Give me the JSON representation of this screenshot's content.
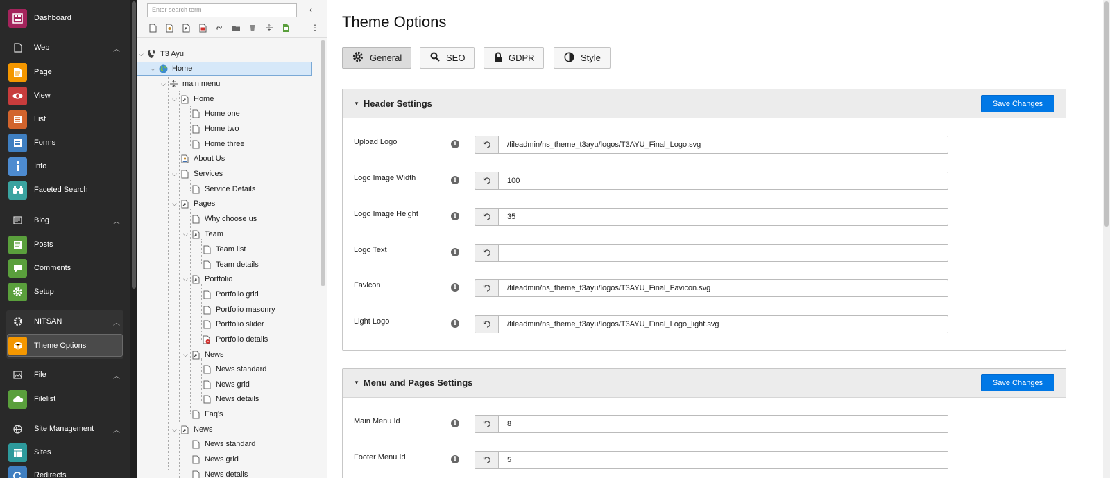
{
  "module_menu": {
    "dashboard": "Dashboard",
    "groups": {
      "web": "Web",
      "blog": "Blog",
      "nitsan": "NITSAN",
      "file": "File",
      "site_management": "Site Management"
    },
    "items": {
      "page": "Page",
      "view": "View",
      "list": "List",
      "forms": "Forms",
      "info": "Info",
      "faceted_search": "Faceted Search",
      "posts": "Posts",
      "comments": "Comments",
      "setup": "Setup",
      "theme_options": "Theme Options",
      "filelist": "Filelist",
      "sites": "Sites",
      "redirects": "Redirects"
    },
    "colors": {
      "dashboard": "#a4245c",
      "web": "#f49700",
      "view": "#c83c3c",
      "list": "#d2642d",
      "forms": "#3f7fc1",
      "info": "#4d8bd0",
      "faceted_search": "#3aa3a0",
      "blog": "#5a9f3c",
      "theme_options": "#f49700",
      "filelist": "#5a9f3c",
      "sites": "#2d9a9c",
      "redirects": "#3f7fc1"
    }
  },
  "page_tree": {
    "search_placeholder": "Enter search term",
    "root": "T3 Ayu",
    "nodes": [
      "Home",
      "main menu",
      "Home",
      "Home one",
      "Home two",
      "Home three",
      "About Us",
      "Services",
      "Service Details",
      "Pages",
      "Why choose us",
      "Team",
      "Team list",
      "Team details",
      "Portfolio",
      "Portfolio grid",
      "Portfolio masonry",
      "Portfolio slider",
      "Portfolio details",
      "News",
      "News standard",
      "News grid",
      "News details",
      "Faq's",
      "News",
      "News standard",
      "News grid",
      "News details"
    ]
  },
  "content": {
    "title": "Theme Options",
    "tabs": [
      "General",
      "SEO",
      "GDPR",
      "Style"
    ],
    "save_label": "Save Changes",
    "sections": [
      {
        "title": "Header Settings",
        "fields": [
          {
            "label": "Upload Logo",
            "value": "/fileadmin/ns_theme_t3ayu/logos/T3AYU_Final_Logo.svg"
          },
          {
            "label": "Logo Image Width",
            "value": "100"
          },
          {
            "label": "Logo Image Height",
            "value": "35"
          },
          {
            "label": "Logo Text",
            "value": ""
          },
          {
            "label": "Favicon",
            "value": "/fileadmin/ns_theme_t3ayu/logos/T3AYU_Final_Favicon.svg"
          },
          {
            "label": "Light Logo",
            "value": "/fileadmin/ns_theme_t3ayu/logos/T3AYU_Final_Logo_light.svg"
          }
        ]
      },
      {
        "title": "Menu and Pages Settings",
        "fields": [
          {
            "label": "Main Menu Id",
            "value": "8"
          },
          {
            "label": "Footer Menu Id",
            "value": "5"
          }
        ]
      }
    ],
    "info_glyph": "i"
  }
}
